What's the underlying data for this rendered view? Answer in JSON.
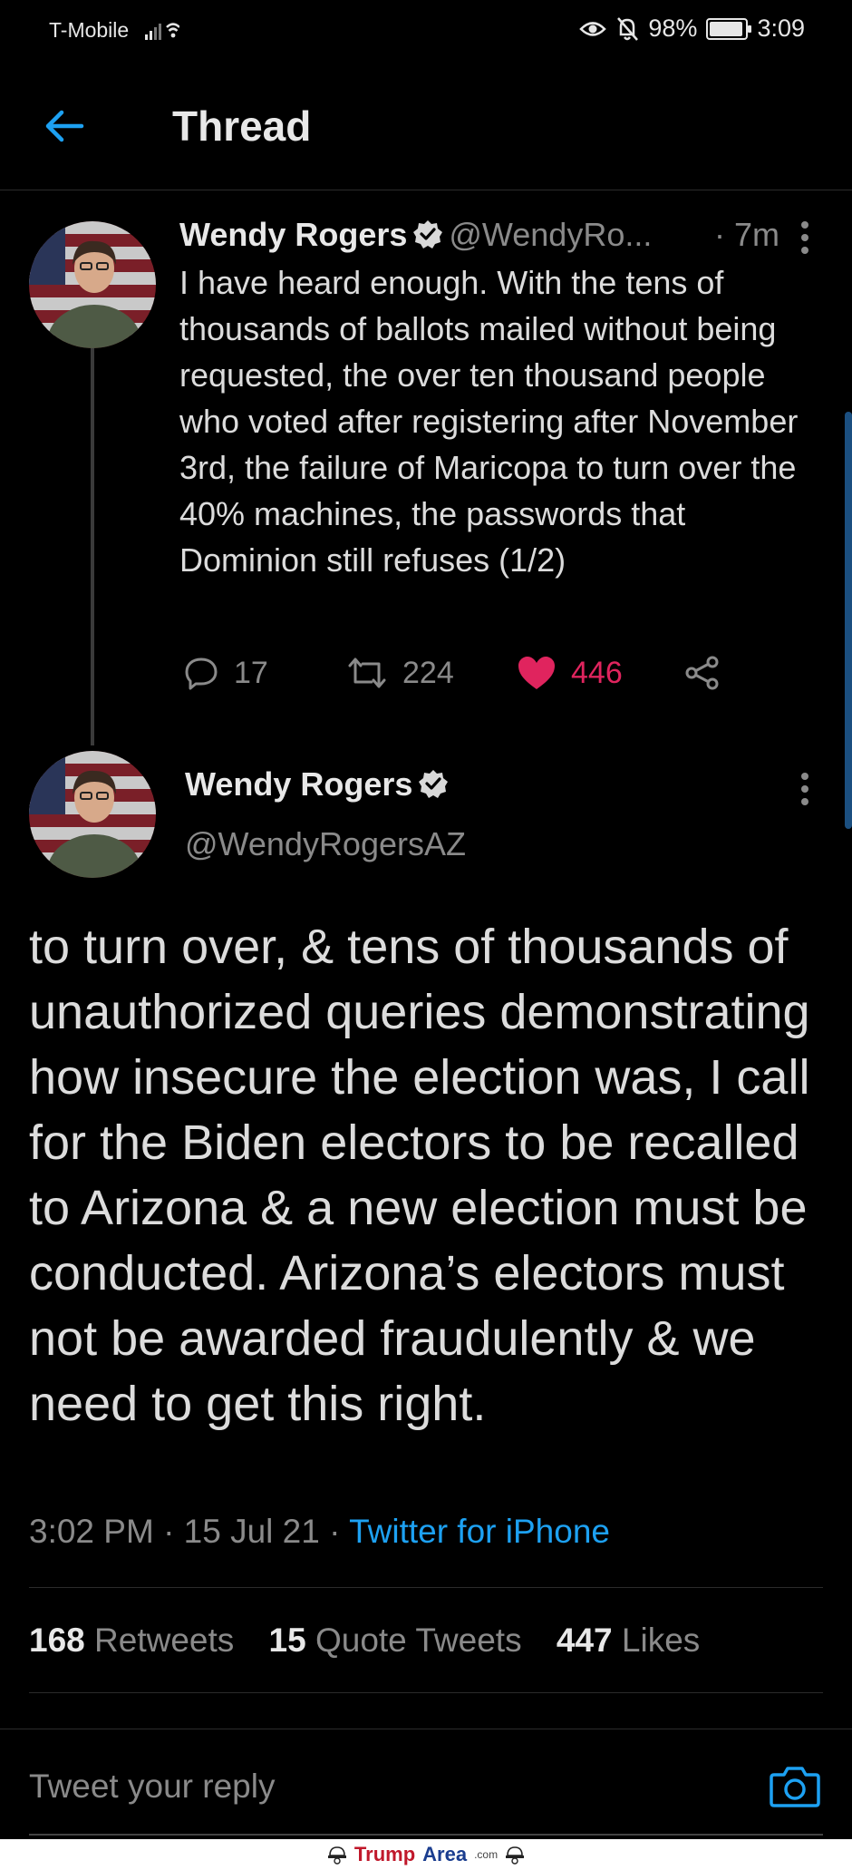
{
  "status_bar": {
    "carrier": "T-Mobile",
    "battery": "98%",
    "time": "3:09"
  },
  "header": {
    "title": "Thread"
  },
  "tweet1": {
    "name": "Wendy Rogers",
    "handle": "@WendyRo...",
    "time": "· 7m",
    "text": "I have heard enough. With the tens of thousands of ballots mailed without being requested, the over ten thousand people who voted after registering after November 3rd, the failure of Maricopa to turn over the 40% machines, the passwords that Dominion still refuses (1/2)",
    "replies": "17",
    "retweets": "224",
    "likes": "446"
  },
  "tweet2": {
    "name": "Wendy Rogers",
    "handle": "@WendyRogersAZ",
    "text": "to turn over, & tens of thousands of unauthorized queries demonstrating how insecure the election was, I call for the Biden electors to be recalled to Arizona & a new election must be conducted. Arizona’s electors must not be awarded fraudulently & we need to get this right.",
    "timestamp": "3:02 PM · 15 Jul 21 · ",
    "source": "Twitter for iPhone",
    "retweets_count": "168",
    "retweets_label": "Retweets",
    "quotes_count": "15",
    "quotes_label": "Quote Tweets",
    "likes_count": "447",
    "likes_label": "Likes"
  },
  "reply": {
    "placeholder": "Tweet your reply"
  },
  "watermark": {
    "brand": "Trump",
    "domain": "Area",
    "tld": ".com"
  },
  "colors": {
    "accent": "#1da1f2",
    "like": "#e0245e",
    "background": "#000000"
  }
}
